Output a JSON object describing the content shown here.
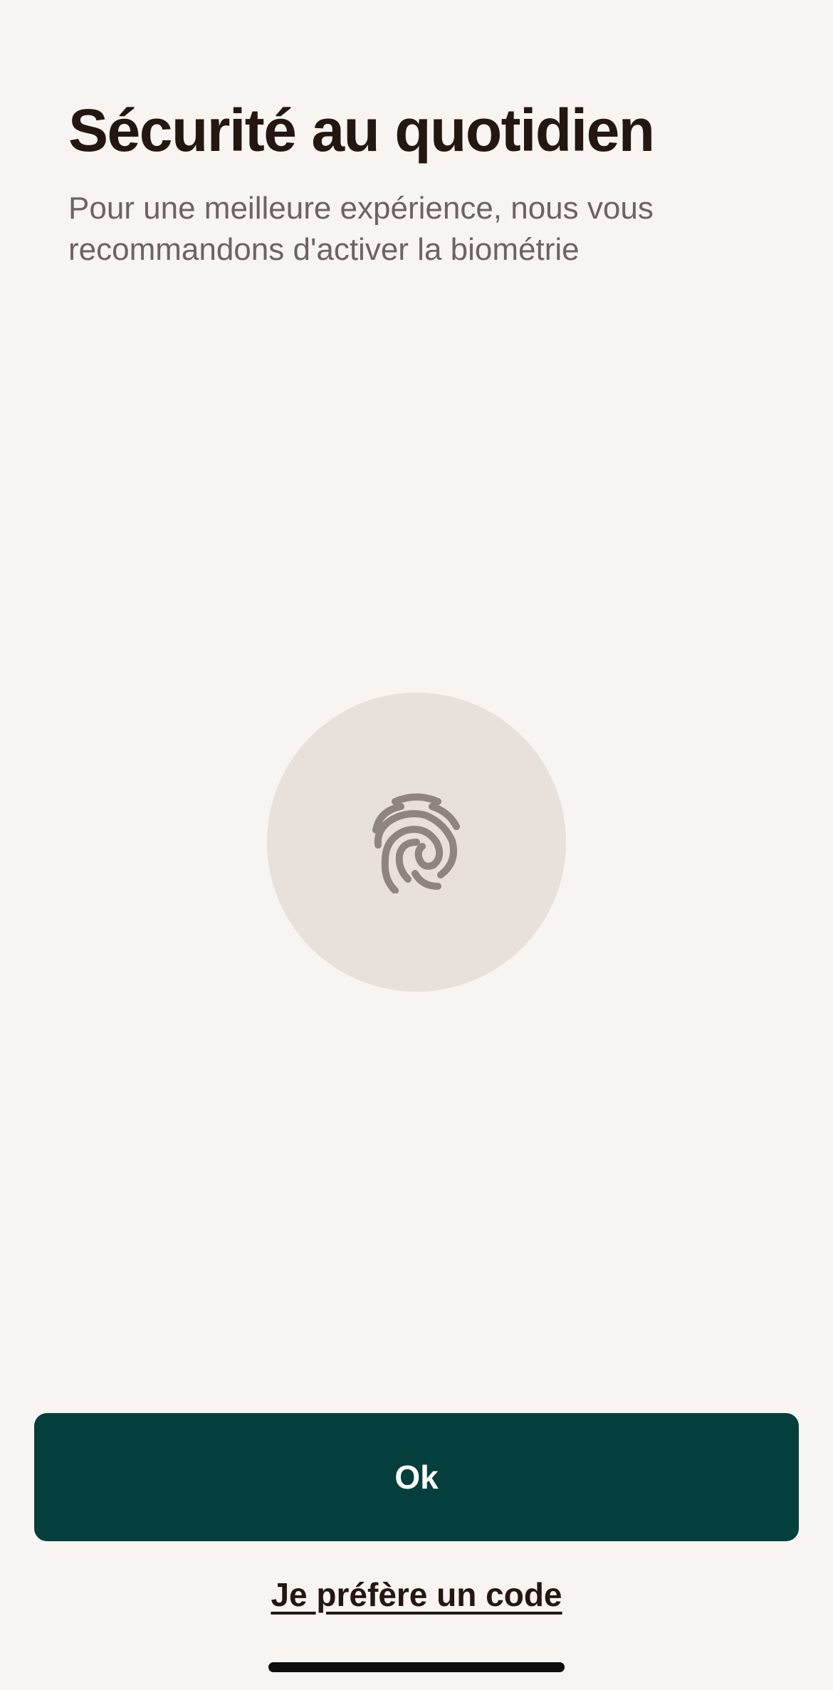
{
  "header": {
    "title": "Sécurité au quotidien",
    "subtitle": "Pour une meilleure expérience, nous vous recommandons d'activer la biométrie"
  },
  "biometric": {
    "icon": "fingerprint-icon",
    "circle_color": "#e7e0db",
    "icon_color": "#8f8580"
  },
  "actions": {
    "ok_label": "Ok",
    "alternate_label": "Je préfère un code"
  },
  "colors": {
    "background": "#f7f4f2",
    "primary": "#053f3d",
    "text": "#241611",
    "muted_text": "#6d6360"
  }
}
